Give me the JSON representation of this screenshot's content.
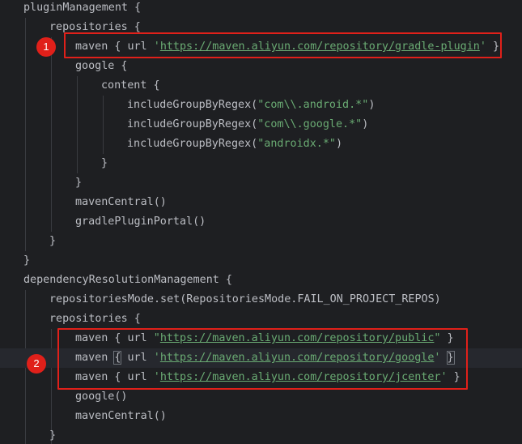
{
  "code_lines": [
    {
      "indent": 0,
      "text": "pluginManagement {"
    },
    {
      "indent": 1,
      "text": "repositories {"
    },
    {
      "indent": 2,
      "parts": [
        {
          "t": "maven { url "
        },
        {
          "t": "'",
          "c": "str"
        },
        {
          "t": "https://maven.aliyun.com/repository/gradle-plugin",
          "c": "str url"
        },
        {
          "t": "'",
          "c": "str"
        },
        {
          "t": " }"
        }
      ]
    },
    {
      "indent": 2,
      "text": "google {"
    },
    {
      "indent": 3,
      "text": "content {"
    },
    {
      "indent": 4,
      "parts": [
        {
          "t": "includeGroupByRegex("
        },
        {
          "t": "\"com\\\\.android.*\"",
          "c": "str"
        },
        {
          "t": ")"
        }
      ]
    },
    {
      "indent": 4,
      "parts": [
        {
          "t": "includeGroupByRegex("
        },
        {
          "t": "\"com\\\\.google.*\"",
          "c": "str"
        },
        {
          "t": ")"
        }
      ]
    },
    {
      "indent": 4,
      "parts": [
        {
          "t": "includeGroupByRegex("
        },
        {
          "t": "\"androidx.*\"",
          "c": "str"
        },
        {
          "t": ")"
        }
      ]
    },
    {
      "indent": 3,
      "text": "}"
    },
    {
      "indent": 2,
      "text": "}"
    },
    {
      "indent": 2,
      "text": "mavenCentral()"
    },
    {
      "indent": 2,
      "text": "gradlePluginPortal()"
    },
    {
      "indent": 1,
      "text": "}"
    },
    {
      "indent": 0,
      "text": "}"
    },
    {
      "indent": 0,
      "text": "dependencyResolutionManagement {"
    },
    {
      "indent": 1,
      "text": "repositoriesMode.set(RepositoriesMode.FAIL_ON_PROJECT_REPOS)"
    },
    {
      "indent": 1,
      "text": "repositories {"
    },
    {
      "indent": 2,
      "parts": [
        {
          "t": "maven { url "
        },
        {
          "t": "\"",
          "c": "str"
        },
        {
          "t": "https://maven.aliyun.com/repository/public",
          "c": "str url"
        },
        {
          "t": "\"",
          "c": "str"
        },
        {
          "t": " }"
        }
      ]
    },
    {
      "indent": 2,
      "current": true,
      "parts": [
        {
          "t": "maven "
        },
        {
          "t": "{",
          "c": "brace-hl"
        },
        {
          "t": " url "
        },
        {
          "t": "'",
          "c": "str"
        },
        {
          "t": "https://maven.aliyun.com/repository/google",
          "c": "str url"
        },
        {
          "t": "'",
          "c": "str"
        },
        {
          "t": " "
        },
        {
          "t": "}",
          "c": "brace-hl"
        }
      ]
    },
    {
      "indent": 2,
      "parts": [
        {
          "t": "maven { url "
        },
        {
          "t": "'",
          "c": "str"
        },
        {
          "t": "https://maven.aliyun.com/repository/jcenter",
          "c": "str url"
        },
        {
          "t": "'",
          "c": "str"
        },
        {
          "t": " }"
        }
      ]
    },
    {
      "indent": 2,
      "text": "google()"
    },
    {
      "indent": 2,
      "text": "mavenCentral()"
    },
    {
      "indent": 1,
      "text": "}"
    }
  ],
  "annotations": [
    {
      "label": "1"
    },
    {
      "label": "2"
    }
  ],
  "colors": {
    "background": "#1e1f22",
    "text": "#bcbec4",
    "string": "#6aab73",
    "annotation": "#e0201a",
    "indent_guide": "#393b40"
  }
}
